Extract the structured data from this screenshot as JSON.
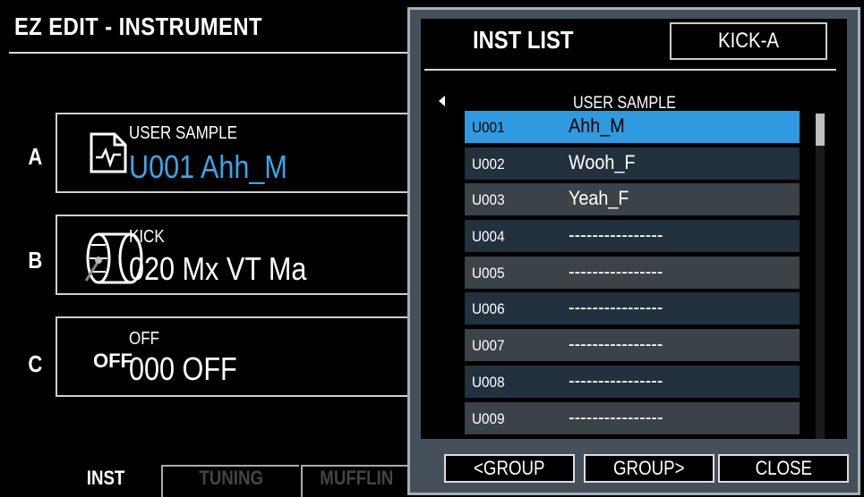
{
  "screen": {
    "title": "EZ EDIT - INSTRUMENT"
  },
  "slots": [
    {
      "letter": "A",
      "category": "USER SAMPLE",
      "name": "U001 Ahh_M",
      "icon": "user-sample-waveform-icon",
      "name_color": "#3aa6e6"
    },
    {
      "letter": "B",
      "category": "KICK",
      "name": "020 Mx VT Ma",
      "icon": "kick-drum-icon",
      "name_color": "#ffffff"
    },
    {
      "letter": "C",
      "category": "OFF",
      "name": "000 OFF",
      "icon_text": "OFF",
      "name_color": "#ffffff"
    }
  ],
  "tabs": [
    {
      "label": "INST",
      "active": true
    },
    {
      "label": "TUNING",
      "active": false
    },
    {
      "label": "MUFFLIN",
      "active": false
    }
  ],
  "popup": {
    "title": "INST LIST",
    "pad": "KICK-A",
    "group": "USER SAMPLE",
    "rows": [
      {
        "num": "U001",
        "name": "Ahh_M",
        "selected": true
      },
      {
        "num": "U002",
        "name": "Wooh_F"
      },
      {
        "num": "U003",
        "name": "Yeah_F"
      },
      {
        "num": "U004",
        "name": "----------------"
      },
      {
        "num": "U005",
        "name": "----------------"
      },
      {
        "num": "U006",
        "name": "----------------"
      },
      {
        "num": "U007",
        "name": "----------------"
      },
      {
        "num": "U008",
        "name": "----------------"
      },
      {
        "num": "U009",
        "name": "----------------"
      }
    ],
    "buttons": {
      "prev_group": "<GROUP",
      "next_group": "GROUP>",
      "close": "CLOSE"
    }
  },
  "colors": {
    "accent": "#2f9ae0",
    "popup_frame": "#46505a"
  }
}
